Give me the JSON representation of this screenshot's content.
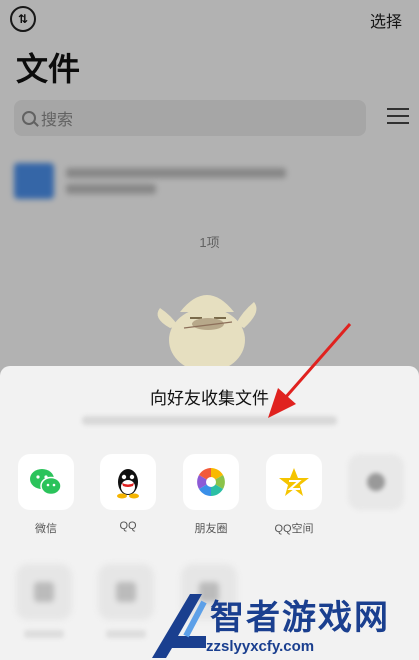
{
  "header": {
    "sort_icon_text": "⇅",
    "select_label": "选择",
    "title": "文件"
  },
  "search": {
    "placeholder": "搜索"
  },
  "list": {
    "count": "1项"
  },
  "sheet": {
    "title": "向好友收集文件",
    "items": [
      {
        "label": "微信",
        "icon": "wechat-icon",
        "color": "#2bc35b"
      },
      {
        "label": "QQ",
        "icon": "qq-icon",
        "color": "#111111"
      },
      {
        "label": "朋友圈",
        "icon": "moments-icon",
        "color": "#f26b3a"
      },
      {
        "label": "QQ空间",
        "icon": "qzone-icon",
        "color": "#f5c400"
      }
    ]
  },
  "watermark": {
    "text": "智者游戏网",
    "url": "zzslyyxcfy.com"
  },
  "colors": {
    "arrow": "#e0221f",
    "accent": "#2bc35b"
  }
}
